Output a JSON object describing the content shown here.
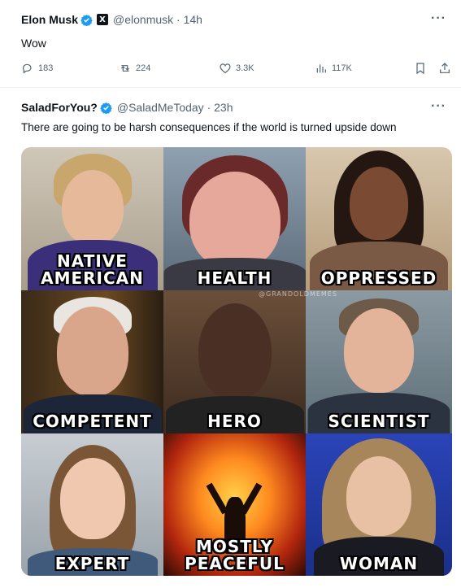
{
  "main_tweet": {
    "author_name": "Elon Musk",
    "x_badge": "X",
    "handle_time": "@elonmusk · 14h",
    "more": "···",
    "text": "Wow",
    "replies": "183",
    "retweets": "224",
    "likes": "3.3K",
    "views": "117K"
  },
  "quoted_tweet": {
    "author_name": "SaladForYou?",
    "handle_time": "@SaladMeToday · 23h",
    "more": "···",
    "text": "There are going to be harsh consequences if the world is turned upside down",
    "meme": {
      "watermark": "@GRANDOLDMEMES",
      "cells": [
        {
          "caption_line1": "NATIVE",
          "caption_line2": "AMERICAN"
        },
        {
          "caption_line1": "",
          "caption_line2": "HEALTH"
        },
        {
          "caption_line1": "",
          "caption_line2": "OPPRESSED"
        },
        {
          "caption_line1": "",
          "caption_line2": "COMPETENT"
        },
        {
          "caption_line1": "",
          "caption_line2": "HERO"
        },
        {
          "caption_line1": "",
          "caption_line2": "SCIENTIST"
        },
        {
          "caption_line1": "",
          "caption_line2": "EXPERT"
        },
        {
          "caption_line1": "MOSTLY",
          "caption_line2": "PEACEFUL"
        },
        {
          "caption_line1": "",
          "caption_line2": "WOMAN"
        }
      ]
    }
  },
  "colors": {
    "verified": "#1d9bf0",
    "muted": "#536471",
    "text": "#0f1419"
  }
}
